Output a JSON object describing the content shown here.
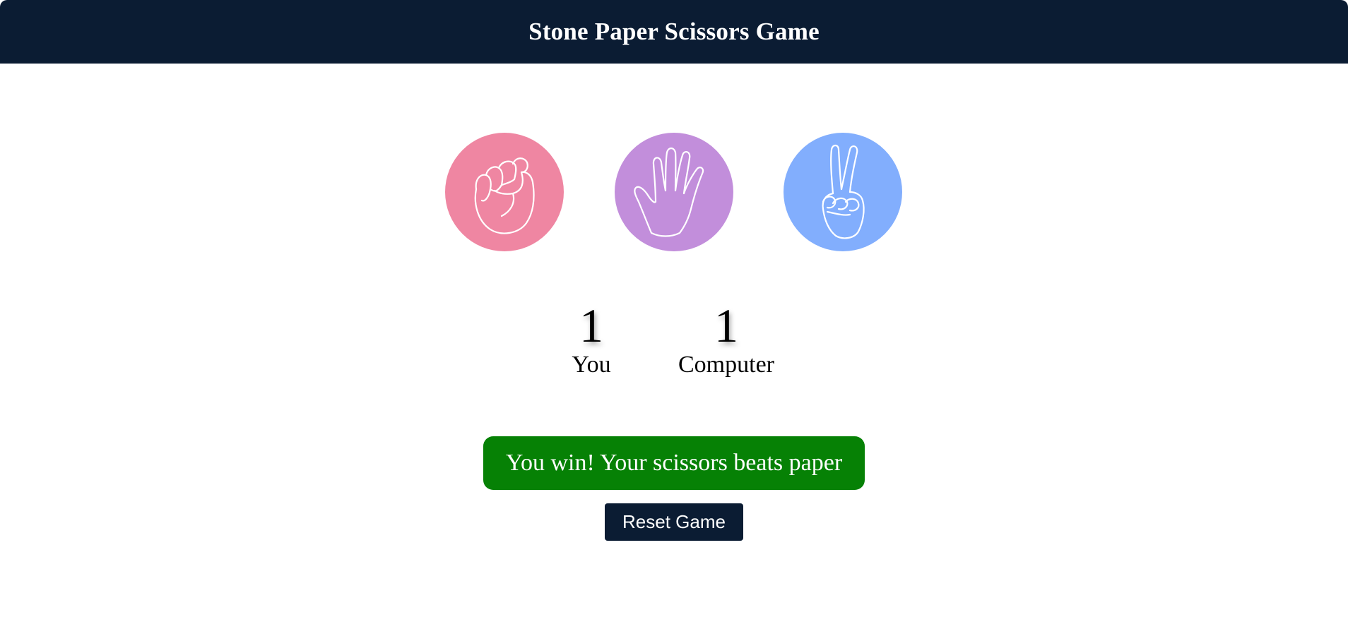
{
  "header": {
    "title": "Stone Paper Scissors Game",
    "background": "#0b1c33"
  },
  "choices": [
    {
      "id": "stone",
      "icon": "fist-icon",
      "color": "#ef86a2"
    },
    {
      "id": "paper",
      "icon": "open-hand-icon",
      "color": "#c28edb"
    },
    {
      "id": "scissors",
      "icon": "peace-hand-icon",
      "color": "#82aefd"
    }
  ],
  "scoreboard": {
    "user_score": "1",
    "user_label": "You",
    "computer_score": "1",
    "computer_label": "Computer"
  },
  "message": {
    "text": "You win! Your scissors beats paper",
    "background": "#068105"
  },
  "reset_button": {
    "label": "Reset Game",
    "background": "#0b1c33"
  }
}
